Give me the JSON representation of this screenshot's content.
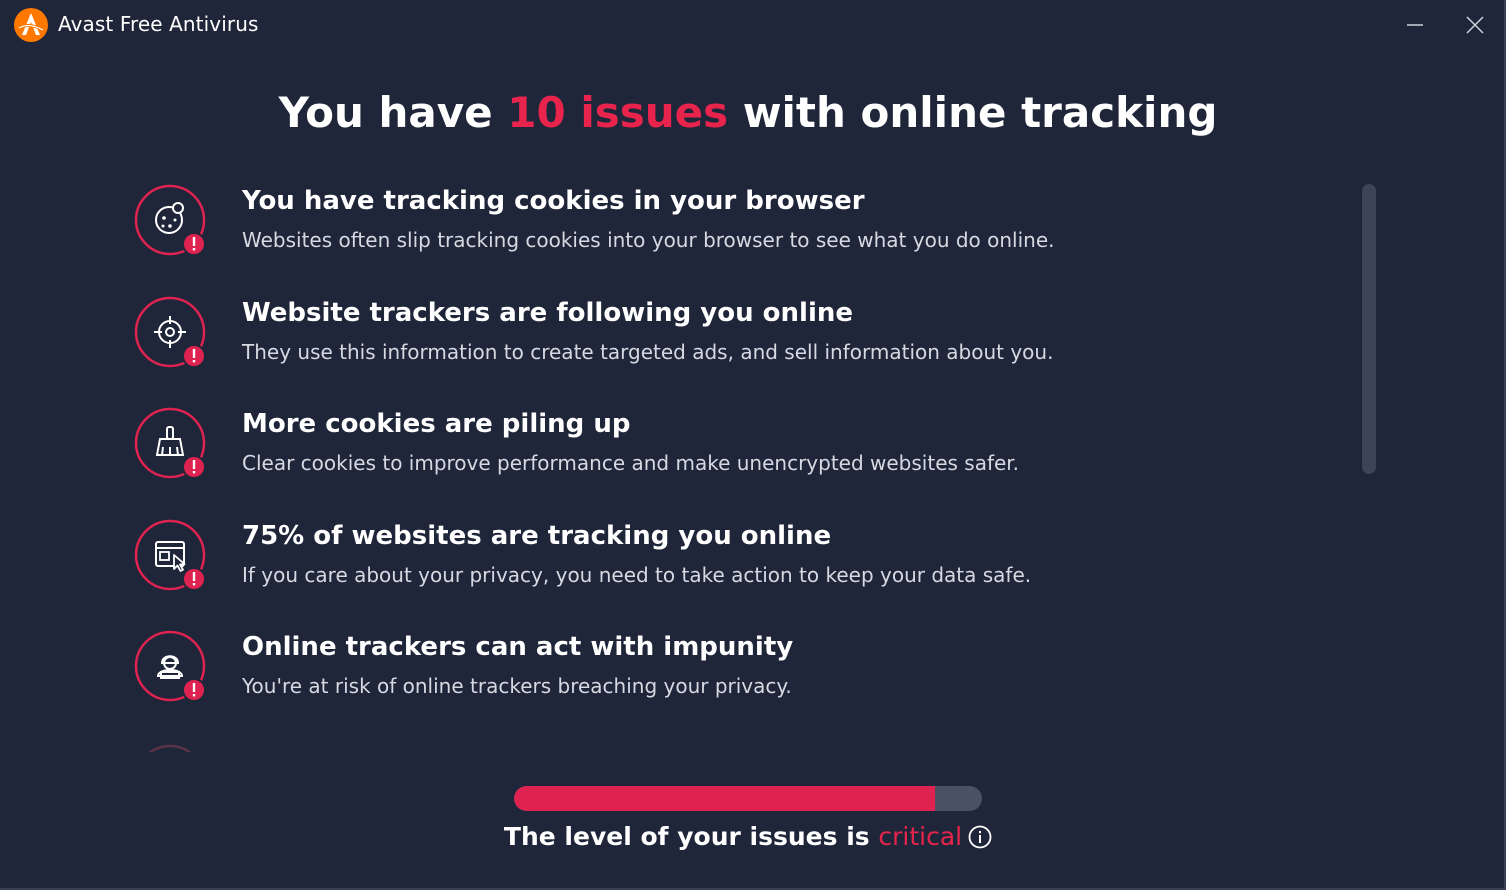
{
  "window": {
    "title": "Avast Free Antivirus"
  },
  "headline": {
    "prefix": "You have ",
    "accent": "10 issues",
    "suffix": " with online tracking"
  },
  "issues": [
    {
      "icon": "cookie-icon",
      "title": "You have tracking cookies in your browser",
      "description": "Websites often slip tracking cookies into your browser to see what you do online."
    },
    {
      "icon": "crosshair-icon",
      "title": "Website trackers are following you online",
      "description": "They use this information to create targeted ads, and sell information about you."
    },
    {
      "icon": "broom-icon",
      "title": "More cookies are piling up",
      "description": "Clear cookies to improve performance and make unencrypted websites safer."
    },
    {
      "icon": "browser-cursor-icon",
      "title": "75% of websites are tracking you online",
      "description": "If you care about your privacy, you need to take action to keep your data safe."
    },
    {
      "icon": "hacker-icon",
      "title": "Online trackers can act with impunity",
      "description": "You're at risk of online trackers breaching your privacy."
    }
  ],
  "level": {
    "fraction": 0.9,
    "prefix": "The level of your issues is ",
    "status": "critical"
  },
  "colors": {
    "background": "#1f2639",
    "accent": "#e8244c",
    "track": "#4a5163",
    "brand_orange": "#ff7800"
  }
}
